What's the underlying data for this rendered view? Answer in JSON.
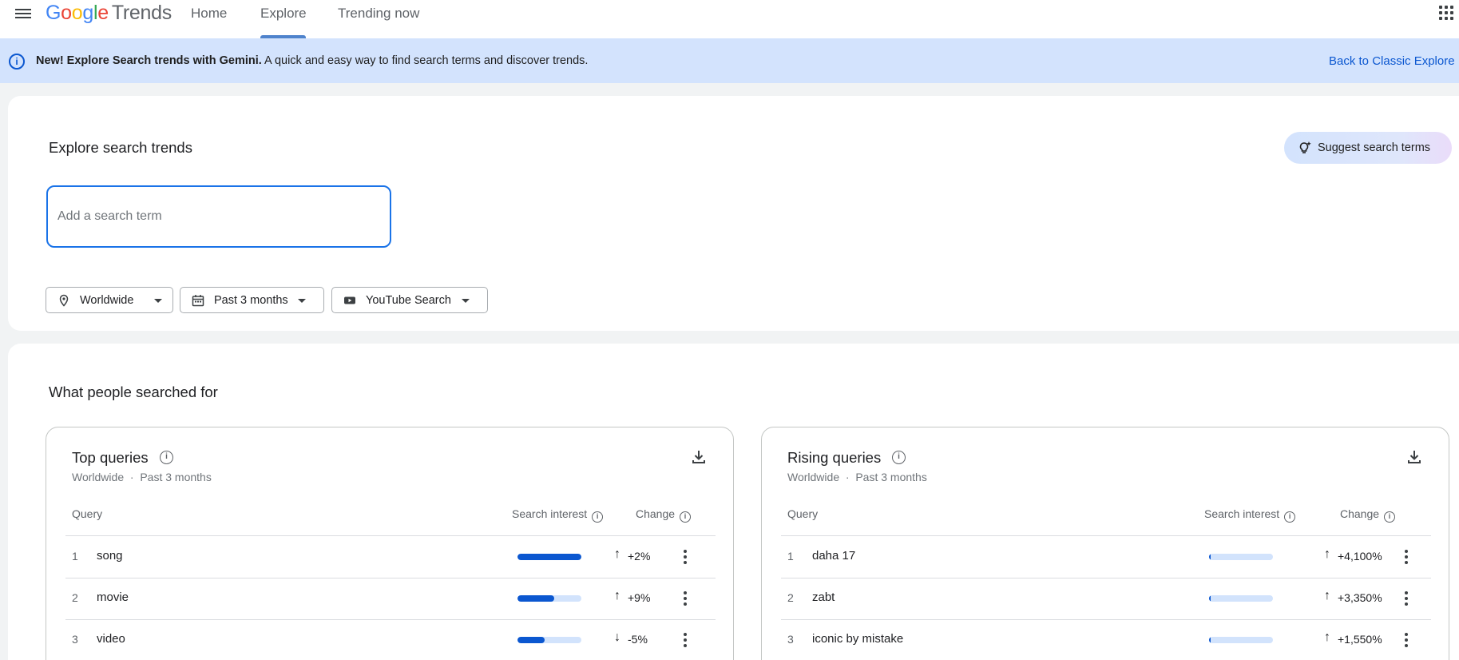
{
  "header": {
    "logo": {
      "g1": "G",
      "g2": "o",
      "g3": "o",
      "g4": "g",
      "g5": "l",
      "g6": "e",
      "product": "Trends"
    },
    "tabs": [
      {
        "label": "Home"
      },
      {
        "label": "Explore",
        "active": true
      },
      {
        "label": "Trending now"
      }
    ],
    "icons": {
      "menu": "hamburger-menu-icon",
      "apps": "apps-grid-icon"
    }
  },
  "banner": {
    "bold": "New! Explore Search trends with Gemini.",
    "text": " A quick and easy way to find search terms and discover trends.",
    "link": "Back to Classic Explore",
    "icon": "info-icon"
  },
  "explore": {
    "title": "Explore search trends",
    "suggest_label": "Suggest search terms",
    "search": {
      "value": "",
      "placeholder": "Add a search term"
    },
    "filters": [
      {
        "label": "Worldwide",
        "icon": "location-pin-icon"
      },
      {
        "label": "Past 3 months",
        "icon": "calendar-icon"
      },
      {
        "label": "YouTube Search",
        "icon": "youtube-icon"
      }
    ]
  },
  "results": {
    "title": "What people searched for",
    "columns": {
      "query": "Query",
      "interest": "Search interest",
      "change": "Change"
    },
    "top": {
      "title": "Top queries",
      "location": "Worldwide",
      "separator": "·",
      "period": "Past 3 months",
      "rows": [
        {
          "rank": "1",
          "query": "song",
          "interest": 1.0,
          "direction": "up",
          "change": "+2%"
        },
        {
          "rank": "2",
          "query": "movie",
          "interest": 0.58,
          "direction": "up",
          "change": "+9%"
        },
        {
          "rank": "3",
          "query": "video",
          "interest": 0.42,
          "direction": "down",
          "change": "-5%"
        }
      ]
    },
    "rising": {
      "title": "Rising queries",
      "location": "Worldwide",
      "separator": "·",
      "period": "Past 3 months",
      "rows": [
        {
          "rank": "1",
          "query": "daha 17",
          "interest": 0.03,
          "direction": "up",
          "change": "+4,100%"
        },
        {
          "rank": "2",
          "query": "zabt",
          "interest": 0.03,
          "direction": "up",
          "change": "+3,350%"
        },
        {
          "rank": "3",
          "query": "iconic by mistake",
          "interest": 0.03,
          "direction": "up",
          "change": "+1,550%"
        }
      ]
    }
  },
  "colors": {
    "accent": "#0b57d0",
    "banner_bg": "#d3e3fd",
    "bar_track": "#d2e3fc",
    "tab_underline": "#4f83cc"
  }
}
